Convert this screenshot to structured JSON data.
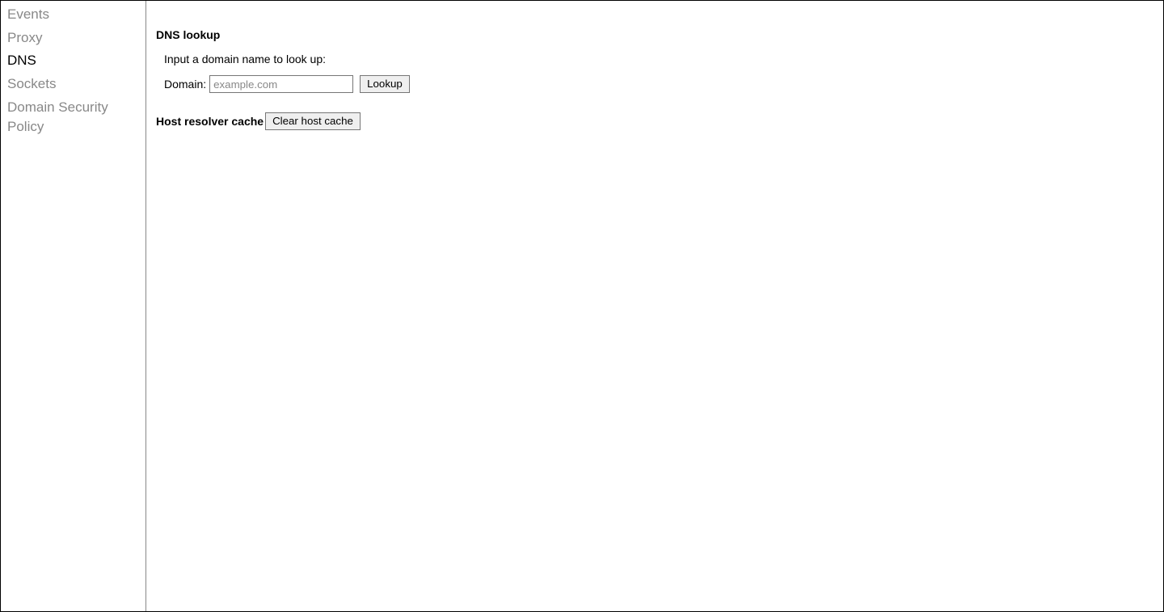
{
  "sidebar": {
    "items": [
      {
        "label": "Events",
        "active": false
      },
      {
        "label": "Proxy",
        "active": false
      },
      {
        "label": "DNS",
        "active": true
      },
      {
        "label": "Sockets",
        "active": false
      },
      {
        "label": "Domain Security Policy",
        "active": false
      }
    ]
  },
  "main": {
    "dns_lookup": {
      "heading": "DNS lookup",
      "instruction": "Input a domain name to look up:",
      "domain_label": "Domain:",
      "domain_placeholder": "example.com",
      "domain_value": "",
      "lookup_button": "Lookup"
    },
    "host_resolver_cache": {
      "heading": "Host resolver cache",
      "clear_button": "Clear host cache"
    }
  }
}
